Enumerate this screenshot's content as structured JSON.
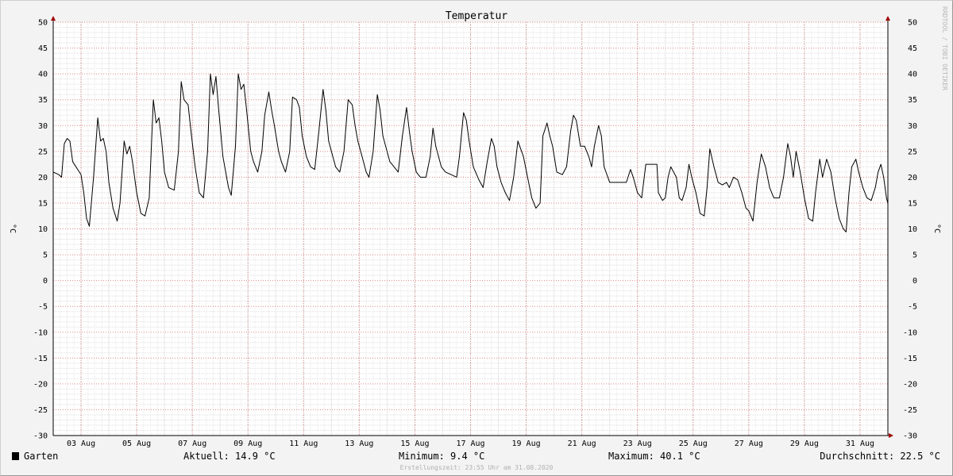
{
  "chart_data": {
    "type": "line",
    "title": "Temperatur",
    "ylabel": "°C",
    "y2label": "°C",
    "ylim": [
      -30,
      50
    ],
    "yticks": [
      50,
      45,
      40,
      35,
      30,
      25,
      20,
      15,
      10,
      5,
      0,
      -5,
      -10,
      -15,
      -20,
      -25,
      -30
    ],
    "xlim_day": [
      2,
      32
    ],
    "xticks": [
      {
        "day": 3,
        "label": "03 Aug"
      },
      {
        "day": 5,
        "label": "05 Aug"
      },
      {
        "day": 7,
        "label": "07 Aug"
      },
      {
        "day": 9,
        "label": "09 Aug"
      },
      {
        "day": 11,
        "label": "11 Aug"
      },
      {
        "day": 13,
        "label": "13 Aug"
      },
      {
        "day": 15,
        "label": "15 Aug"
      },
      {
        "day": 17,
        "label": "17 Aug"
      },
      {
        "day": 19,
        "label": "19 Aug"
      },
      {
        "day": 21,
        "label": "21 Aug"
      },
      {
        "day": 23,
        "label": "23 Aug"
      },
      {
        "day": 25,
        "label": "25 Aug"
      },
      {
        "day": 27,
        "label": "27 Aug"
      },
      {
        "day": 29,
        "label": "29 Aug"
      },
      {
        "day": 31,
        "label": "31 Aug"
      }
    ],
    "grid": true,
    "legend_position": "bottom-left",
    "series": [
      {
        "name": "Garten",
        "color": "#000000",
        "points": [
          [
            2.0,
            21
          ],
          [
            2.2,
            20.5
          ],
          [
            2.3,
            20
          ],
          [
            2.4,
            26.5
          ],
          [
            2.5,
            27.5
          ],
          [
            2.6,
            27
          ],
          [
            2.7,
            23
          ],
          [
            3.0,
            20.5
          ],
          [
            3.1,
            17
          ],
          [
            3.2,
            12
          ],
          [
            3.3,
            10.5
          ],
          [
            3.45,
            20
          ],
          [
            3.6,
            31.5
          ],
          [
            3.7,
            27
          ],
          [
            3.8,
            27.5
          ],
          [
            3.9,
            25
          ],
          [
            4.0,
            19
          ],
          [
            4.15,
            14
          ],
          [
            4.3,
            11.5
          ],
          [
            4.4,
            15
          ],
          [
            4.55,
            27
          ],
          [
            4.65,
            24.5
          ],
          [
            4.75,
            26
          ],
          [
            4.85,
            23
          ],
          [
            5.0,
            17
          ],
          [
            5.15,
            13
          ],
          [
            5.3,
            12.5
          ],
          [
            5.45,
            16
          ],
          [
            5.6,
            35
          ],
          [
            5.7,
            30.5
          ],
          [
            5.8,
            31.5
          ],
          [
            5.9,
            27
          ],
          [
            6.0,
            21
          ],
          [
            6.15,
            18
          ],
          [
            6.35,
            17.5
          ],
          [
            6.5,
            25
          ],
          [
            6.6,
            38.5
          ],
          [
            6.7,
            35
          ],
          [
            6.85,
            34
          ],
          [
            6.95,
            29
          ],
          [
            7.1,
            22
          ],
          [
            7.25,
            17
          ],
          [
            7.4,
            16
          ],
          [
            7.55,
            25
          ],
          [
            7.65,
            40
          ],
          [
            7.75,
            36
          ],
          [
            7.85,
            39.5
          ],
          [
            7.95,
            33
          ],
          [
            8.1,
            24
          ],
          [
            8.3,
            18
          ],
          [
            8.4,
            16.5
          ],
          [
            8.55,
            26
          ],
          [
            8.65,
            40
          ],
          [
            8.75,
            37
          ],
          [
            8.85,
            38
          ],
          [
            8.95,
            33
          ],
          [
            9.1,
            25
          ],
          [
            9.2,
            23
          ],
          [
            9.35,
            21
          ],
          [
            9.5,
            25
          ],
          [
            9.6,
            32
          ],
          [
            9.75,
            36.5
          ],
          [
            9.85,
            33
          ],
          [
            9.95,
            30
          ],
          [
            10.1,
            25
          ],
          [
            10.2,
            23
          ],
          [
            10.35,
            21
          ],
          [
            10.5,
            25
          ],
          [
            10.6,
            35.5
          ],
          [
            10.75,
            35
          ],
          [
            10.85,
            33.5
          ],
          [
            10.95,
            28
          ],
          [
            11.1,
            24
          ],
          [
            11.25,
            22
          ],
          [
            11.4,
            21.5
          ],
          [
            11.55,
            29
          ],
          [
            11.7,
            37
          ],
          [
            11.8,
            33
          ],
          [
            11.9,
            27
          ],
          [
            12.0,
            25
          ],
          [
            12.15,
            22
          ],
          [
            12.3,
            21
          ],
          [
            12.45,
            25
          ],
          [
            12.6,
            35
          ],
          [
            12.75,
            34
          ],
          [
            12.85,
            30
          ],
          [
            12.95,
            27
          ],
          [
            13.1,
            24
          ],
          [
            13.25,
            21
          ],
          [
            13.35,
            20
          ],
          [
            13.5,
            25
          ],
          [
            13.65,
            36
          ],
          [
            13.75,
            33
          ],
          [
            13.85,
            28
          ],
          [
            13.95,
            26
          ],
          [
            14.1,
            23
          ],
          [
            14.25,
            22
          ],
          [
            14.4,
            21
          ],
          [
            14.55,
            28
          ],
          [
            14.7,
            33.5
          ],
          [
            14.8,
            29
          ],
          [
            14.9,
            25
          ],
          [
            15.05,
            21
          ],
          [
            15.2,
            20
          ],
          [
            15.4,
            20
          ],
          [
            15.55,
            24
          ],
          [
            15.65,
            29.5
          ],
          [
            15.75,
            26
          ],
          [
            15.85,
            24
          ],
          [
            15.95,
            22
          ],
          [
            16.1,
            21
          ],
          [
            16.3,
            20.5
          ],
          [
            16.5,
            20
          ],
          [
            16.6,
            24
          ],
          [
            16.75,
            32.5
          ],
          [
            16.85,
            31
          ],
          [
            16.95,
            27
          ],
          [
            17.1,
            22
          ],
          [
            17.3,
            19.5
          ],
          [
            17.45,
            18
          ],
          [
            17.6,
            23
          ],
          [
            17.75,
            27.5
          ],
          [
            17.85,
            26
          ],
          [
            17.95,
            22
          ],
          [
            18.1,
            19
          ],
          [
            18.25,
            17
          ],
          [
            18.4,
            15.5
          ],
          [
            18.55,
            20
          ],
          [
            18.7,
            27
          ],
          [
            18.8,
            25.5
          ],
          [
            18.9,
            24
          ],
          [
            19.05,
            20
          ],
          [
            19.2,
            16
          ],
          [
            19.35,
            14
          ],
          [
            19.5,
            15
          ],
          [
            19.6,
            28
          ],
          [
            19.75,
            30.5
          ],
          [
            19.85,
            28
          ],
          [
            19.95,
            26
          ],
          [
            20.1,
            21
          ],
          [
            20.3,
            20.5
          ],
          [
            20.45,
            22
          ],
          [
            20.6,
            29
          ],
          [
            20.7,
            32
          ],
          [
            20.8,
            31
          ],
          [
            20.95,
            26
          ],
          [
            21.1,
            26
          ],
          [
            21.25,
            24
          ],
          [
            21.35,
            22
          ],
          [
            21.45,
            26
          ],
          [
            21.6,
            30
          ],
          [
            21.7,
            28
          ],
          [
            21.8,
            22
          ],
          [
            22.0,
            19
          ],
          [
            22.3,
            19
          ],
          [
            22.6,
            19
          ],
          [
            22.75,
            21.5
          ],
          [
            22.85,
            20
          ],
          [
            23.0,
            17
          ],
          [
            23.15,
            16
          ],
          [
            23.3,
            22.5
          ],
          [
            23.45,
            22.5
          ],
          [
            23.7,
            22.5
          ],
          [
            23.75,
            17
          ],
          [
            23.9,
            15.5
          ],
          [
            24.0,
            16
          ],
          [
            24.1,
            20
          ],
          [
            24.2,
            22
          ],
          [
            24.3,
            21
          ],
          [
            24.4,
            20
          ],
          [
            24.5,
            16
          ],
          [
            24.6,
            15.5
          ],
          [
            24.75,
            18
          ],
          [
            24.85,
            22.5
          ],
          [
            24.95,
            20
          ],
          [
            25.1,
            17
          ],
          [
            25.25,
            13
          ],
          [
            25.4,
            12.5
          ],
          [
            25.5,
            18
          ],
          [
            25.6,
            25.5
          ],
          [
            25.75,
            22
          ],
          [
            25.9,
            19
          ],
          [
            26.05,
            18.5
          ],
          [
            26.2,
            19
          ],
          [
            26.3,
            18
          ],
          [
            26.45,
            20
          ],
          [
            26.6,
            19.5
          ],
          [
            26.75,
            17
          ],
          [
            26.9,
            14
          ],
          [
            27.0,
            13.5
          ],
          [
            27.15,
            11.5
          ],
          [
            27.3,
            19
          ],
          [
            27.45,
            24.5
          ],
          [
            27.6,
            22
          ],
          [
            27.75,
            18
          ],
          [
            27.9,
            16
          ],
          [
            28.1,
            16
          ],
          [
            28.25,
            20
          ],
          [
            28.4,
            26.5
          ],
          [
            28.5,
            24
          ],
          [
            28.6,
            20
          ],
          [
            28.7,
            25
          ],
          [
            28.85,
            21
          ],
          [
            29.0,
            16
          ],
          [
            29.15,
            12
          ],
          [
            29.3,
            11.5
          ],
          [
            29.4,
            17
          ],
          [
            29.55,
            23.5
          ],
          [
            29.65,
            20
          ],
          [
            29.8,
            23.5
          ],
          [
            29.95,
            21
          ],
          [
            30.1,
            16
          ],
          [
            30.25,
            12
          ],
          [
            30.4,
            10
          ],
          [
            30.5,
            9.4
          ],
          [
            30.6,
            17
          ],
          [
            30.7,
            22
          ],
          [
            30.85,
            23.5
          ],
          [
            30.95,
            21
          ],
          [
            31.1,
            18
          ],
          [
            31.25,
            16
          ],
          [
            31.4,
            15.5
          ],
          [
            31.55,
            18
          ],
          [
            31.65,
            21
          ],
          [
            31.75,
            22.5
          ],
          [
            31.85,
            20
          ],
          [
            31.95,
            16
          ],
          [
            32.0,
            14.9
          ]
        ]
      }
    ]
  },
  "legend": {
    "series_name": "Garten",
    "current_label": "Aktuell:",
    "current_value": "14.9 °C",
    "min_label": "Minimum:",
    "min_value": "9.4 °C",
    "max_label": "Maximum:",
    "max_value": "40.1 °C",
    "avg_label": "Durchschnitt:",
    "avg_value": "22.5 °C"
  },
  "footer": "Erstellungszeit: 23:55 Uhr am 31.08.2020",
  "watermark": "RRDTOOL / TOBI OETIKER"
}
